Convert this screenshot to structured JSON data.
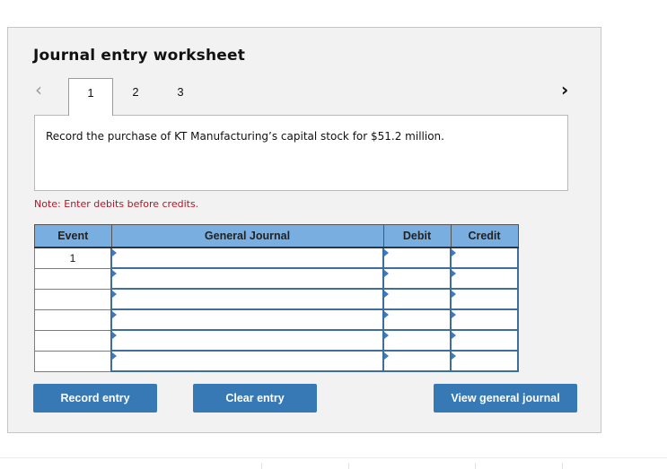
{
  "worksheet": {
    "title": "Journal entry worksheet",
    "nav": {
      "prev_icon": "chevron-left",
      "next_icon": "chevron-right"
    },
    "tabs": [
      {
        "label": "1",
        "active": true
      },
      {
        "label": "2",
        "active": false
      },
      {
        "label": "3",
        "active": false
      }
    ],
    "description": "Record the purchase of KT Manufacturing’s capital stock for $51.2 million.",
    "note": "Note: Enter debits before credits.",
    "table": {
      "headers": {
        "event": "Event",
        "general_journal": "General Journal",
        "debit": "Debit",
        "credit": "Credit"
      },
      "rows": [
        {
          "event": "1",
          "account": "",
          "debit": "",
          "credit": ""
        },
        {
          "event": "",
          "account": "",
          "debit": "",
          "credit": ""
        },
        {
          "event": "",
          "account": "",
          "debit": "",
          "credit": ""
        },
        {
          "event": "",
          "account": "",
          "debit": "",
          "credit": ""
        },
        {
          "event": "",
          "account": "",
          "debit": "",
          "credit": ""
        },
        {
          "event": "",
          "account": "",
          "debit": "",
          "credit": ""
        }
      ]
    },
    "buttons": {
      "record": "Record entry",
      "clear": "Clear entry",
      "view": "View general journal"
    },
    "colors": {
      "header_bg": "#79aee0",
      "button_bg": "#3679b5",
      "note_text": "#b0162a",
      "input_border": "#3e6e9e"
    }
  }
}
